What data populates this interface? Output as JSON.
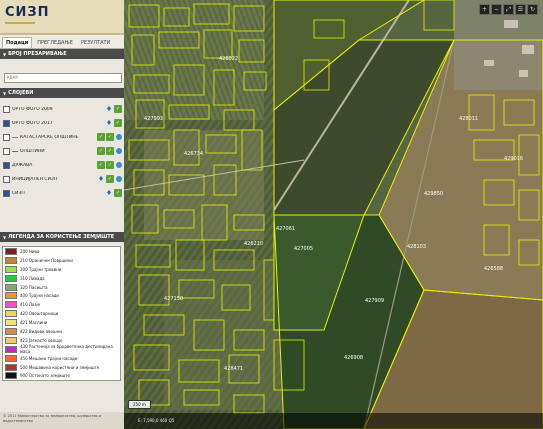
{
  "app": {
    "title": "СИЗП"
  },
  "tabs": [
    {
      "label": "Подаци",
      "active": true
    },
    {
      "label": "ПРЕГЛЕДАЊЕ",
      "active": false
    },
    {
      "label": "РЕЗУЛТАТИ",
      "active": false
    }
  ],
  "search_section": {
    "title": "БРОЈ ПРЕЗАРИВАЊЕ",
    "placeholder": "КВАР"
  },
  "layers_section": {
    "title": "СЛОЈЕВИ",
    "items": [
      {
        "label": "ОРТО ФОТО 2009",
        "checked": false
      },
      {
        "label": "ОРТО ФОТО 2017",
        "checked": true
      },
      {
        "label": "КАТАСТАРСКЕ ОПШТИНЕ",
        "checked": false,
        "line_color": "#c060c0"
      },
      {
        "label": "ОПШТИНИ",
        "checked": false,
        "line_color": "#d04040"
      },
      {
        "label": "ДРЖАВА",
        "checked": true
      },
      {
        "label": "ИНИЦИЈАЛЕН СИЗП",
        "checked": false
      },
      {
        "label": "СИЗП",
        "checked": true
      }
    ]
  },
  "legend_section": {
    "title": "ЛЕГЕНДА ЗА КОРИСТЕЊЕ ЗЕМЈИШТЕ",
    "items": [
      {
        "label": "200 Нива",
        "color": "#7a2222"
      },
      {
        "label": "210 Оранични Површини",
        "color": "#c2843a"
      },
      {
        "label": "300 Трајни тревини",
        "color": "#9be24a"
      },
      {
        "label": "310 Ливада",
        "color": "#2cc83a"
      },
      {
        "label": "320 Пасишта",
        "color": "#8aa86e"
      },
      {
        "label": "400 Трајни насади",
        "color": "#e8963c"
      },
      {
        "label": "410 Лозје",
        "color": "#ea57c4"
      },
      {
        "label": "420 Овоштарници",
        "color": "#ecd84a"
      },
      {
        "label": "421 Маслини",
        "color": "#f0e27c"
      },
      {
        "label": "422 Видови овошни",
        "color": "#d08a52"
      },
      {
        "label": "423 Јаткасто овошје",
        "color": "#f2c86e"
      },
      {
        "label": "430 Растенија за бродветенка дестилирана маса",
        "color": "#c227c8"
      },
      {
        "label": "450 Мешани трајни насади",
        "color": "#f46a2e"
      },
      {
        "label": "500 Мешавина користени и земјиште",
        "color": "#a63a3a"
      },
      {
        "label": "900 Останато земјиште",
        "color": "#111111"
      }
    ]
  },
  "footer": {
    "text": "© 2011 Министерство за земјоделство, шумарство и водостопанство"
  },
  "map": {
    "scale_label": "250 m",
    "coords_label": "E: 7,590,0 460 Q5",
    "controls": [
      "+",
      "−",
      "⤢",
      "☰",
      "↻"
    ],
    "parcels": [
      {
        "label": "427061"
      },
      {
        "label": "428103"
      },
      {
        "label": "427909"
      },
      {
        "label": "426908"
      },
      {
        "label": "429850"
      },
      {
        "label": "428011"
      },
      {
        "label": "427005"
      },
      {
        "label": "426734"
      },
      {
        "label": "427993"
      },
      {
        "label": "428322"
      },
      {
        "label": "426210"
      },
      {
        "label": "427150"
      },
      {
        "label": "428471"
      },
      {
        "label": "429016"
      },
      {
        "label": "426588"
      }
    ]
  }
}
